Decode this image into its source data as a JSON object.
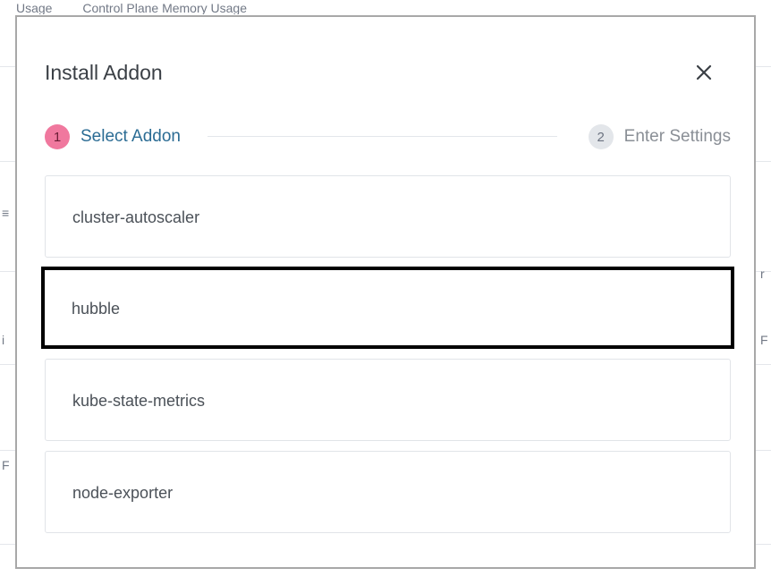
{
  "background": {
    "header_labels": [
      "Usage",
      "Control Plane Memory Usage"
    ],
    "edge_glyphs": [
      "≡",
      "i",
      "F",
      "r",
      "F"
    ]
  },
  "modal": {
    "title": "Install Addon",
    "close_icon": "close-icon"
  },
  "stepper": {
    "steps": [
      {
        "number": "1",
        "label": "Select Addon",
        "state": "active",
        "color": "#f0789e"
      },
      {
        "number": "2",
        "label": "Enter Settings",
        "state": "pending",
        "color": "#e3e6ea"
      }
    ]
  },
  "addons": [
    {
      "name": "cluster-autoscaler",
      "highlighted": false
    },
    {
      "name": "hubble",
      "highlighted": true
    },
    {
      "name": "kube-state-metrics",
      "highlighted": false
    },
    {
      "name": "node-exporter",
      "highlighted": false
    }
  ],
  "colors": {
    "accent": "#2b6c94",
    "active_step": "#f0789e",
    "highlight_border": "#000000"
  }
}
